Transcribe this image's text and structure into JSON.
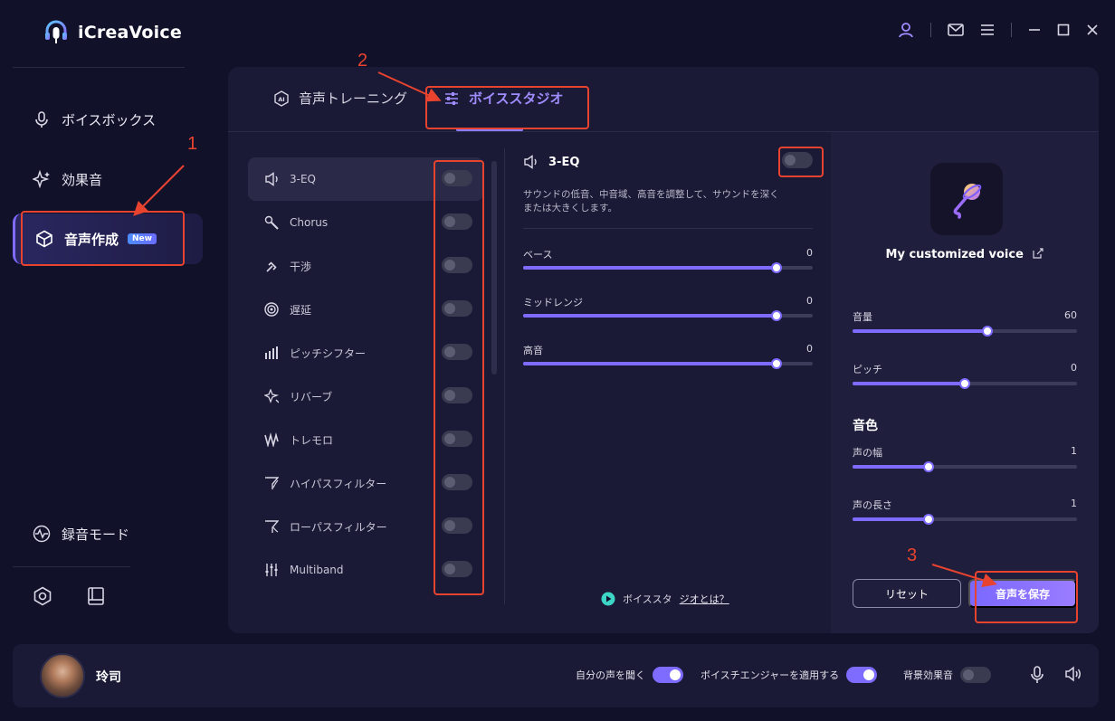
{
  "app": {
    "title": "iCreaVoice"
  },
  "sidebar": {
    "items": [
      {
        "label": "ボイスボックス",
        "icon": "mic-icon"
      },
      {
        "label": "効果音",
        "icon": "sparkle-icon"
      },
      {
        "label": "音声作成",
        "icon": "cube-icon",
        "badge": "New"
      }
    ],
    "bottom_item": {
      "label": "録音モード",
      "icon": "waveform-icon"
    }
  },
  "tabs": [
    {
      "label": "音声トレーニング",
      "icon": "ai-icon"
    },
    {
      "label": "ボイススタジオ",
      "icon": "sliders-icon"
    }
  ],
  "effects": [
    {
      "name": "3-EQ",
      "icon": "speaker-icon",
      "on": false
    },
    {
      "name": "Chorus",
      "icon": "microphone-handheld-icon",
      "on": false
    },
    {
      "name": "干渉",
      "icon": "interference-icon",
      "on": false
    },
    {
      "name": "遅延",
      "icon": "delay-icon",
      "on": false
    },
    {
      "name": "ピッチシフター",
      "icon": "bars-icon",
      "on": false
    },
    {
      "name": "リバーブ",
      "icon": "reverb-icon",
      "on": false
    },
    {
      "name": "トレモロ",
      "icon": "tremolo-icon",
      "on": false
    },
    {
      "name": "ハイパスフィルター",
      "icon": "highpass-icon",
      "on": false
    },
    {
      "name": "ローパスフィルター",
      "icon": "lowpass-icon",
      "on": false
    },
    {
      "name": "Multiband",
      "icon": "multiband-icon",
      "on": false
    }
  ],
  "eq": {
    "title": "3-EQ",
    "enabled": false,
    "description": "サウンドの低音、中音域、高音を調整して、サウンドを深くまたは大きくします。",
    "sliders": [
      {
        "label": "ベース",
        "value": "0",
        "fraction": 0.875
      },
      {
        "label": "ミッドレンジ",
        "value": "0",
        "fraction": 0.875
      },
      {
        "label": "高音",
        "value": "0",
        "fraction": 0.875
      }
    ]
  },
  "help": {
    "prefix": "ボイススタ",
    "link": "ジオとは？"
  },
  "voice": {
    "name": "My customized voice",
    "sliders": [
      {
        "label": "音量",
        "value": "60",
        "fraction": 0.6
      },
      {
        "label": "ピッチ",
        "value": "0",
        "fraction": 0.5
      }
    ],
    "tone_title": "音色",
    "tone_sliders": [
      {
        "label": "声の幅",
        "value": "1",
        "fraction": 0.34
      },
      {
        "label": "声の長さ",
        "value": "1",
        "fraction": 0.34
      }
    ],
    "reset_label": "リセット",
    "save_label": "音声を保存"
  },
  "footer": {
    "user_name": "玲司",
    "listen_label": "自分の声を聞く",
    "listen_on": true,
    "apply_label": "ボイスチエンジャーを適用する",
    "apply_on": true,
    "bg_label": "背景効果音",
    "bg_on": false
  },
  "annotations": [
    "1",
    "2",
    "3"
  ],
  "colors": {
    "accent": "#7d6cff",
    "annotation": "#e8432f",
    "background": "#12112a",
    "panel": "#1b1a36"
  }
}
